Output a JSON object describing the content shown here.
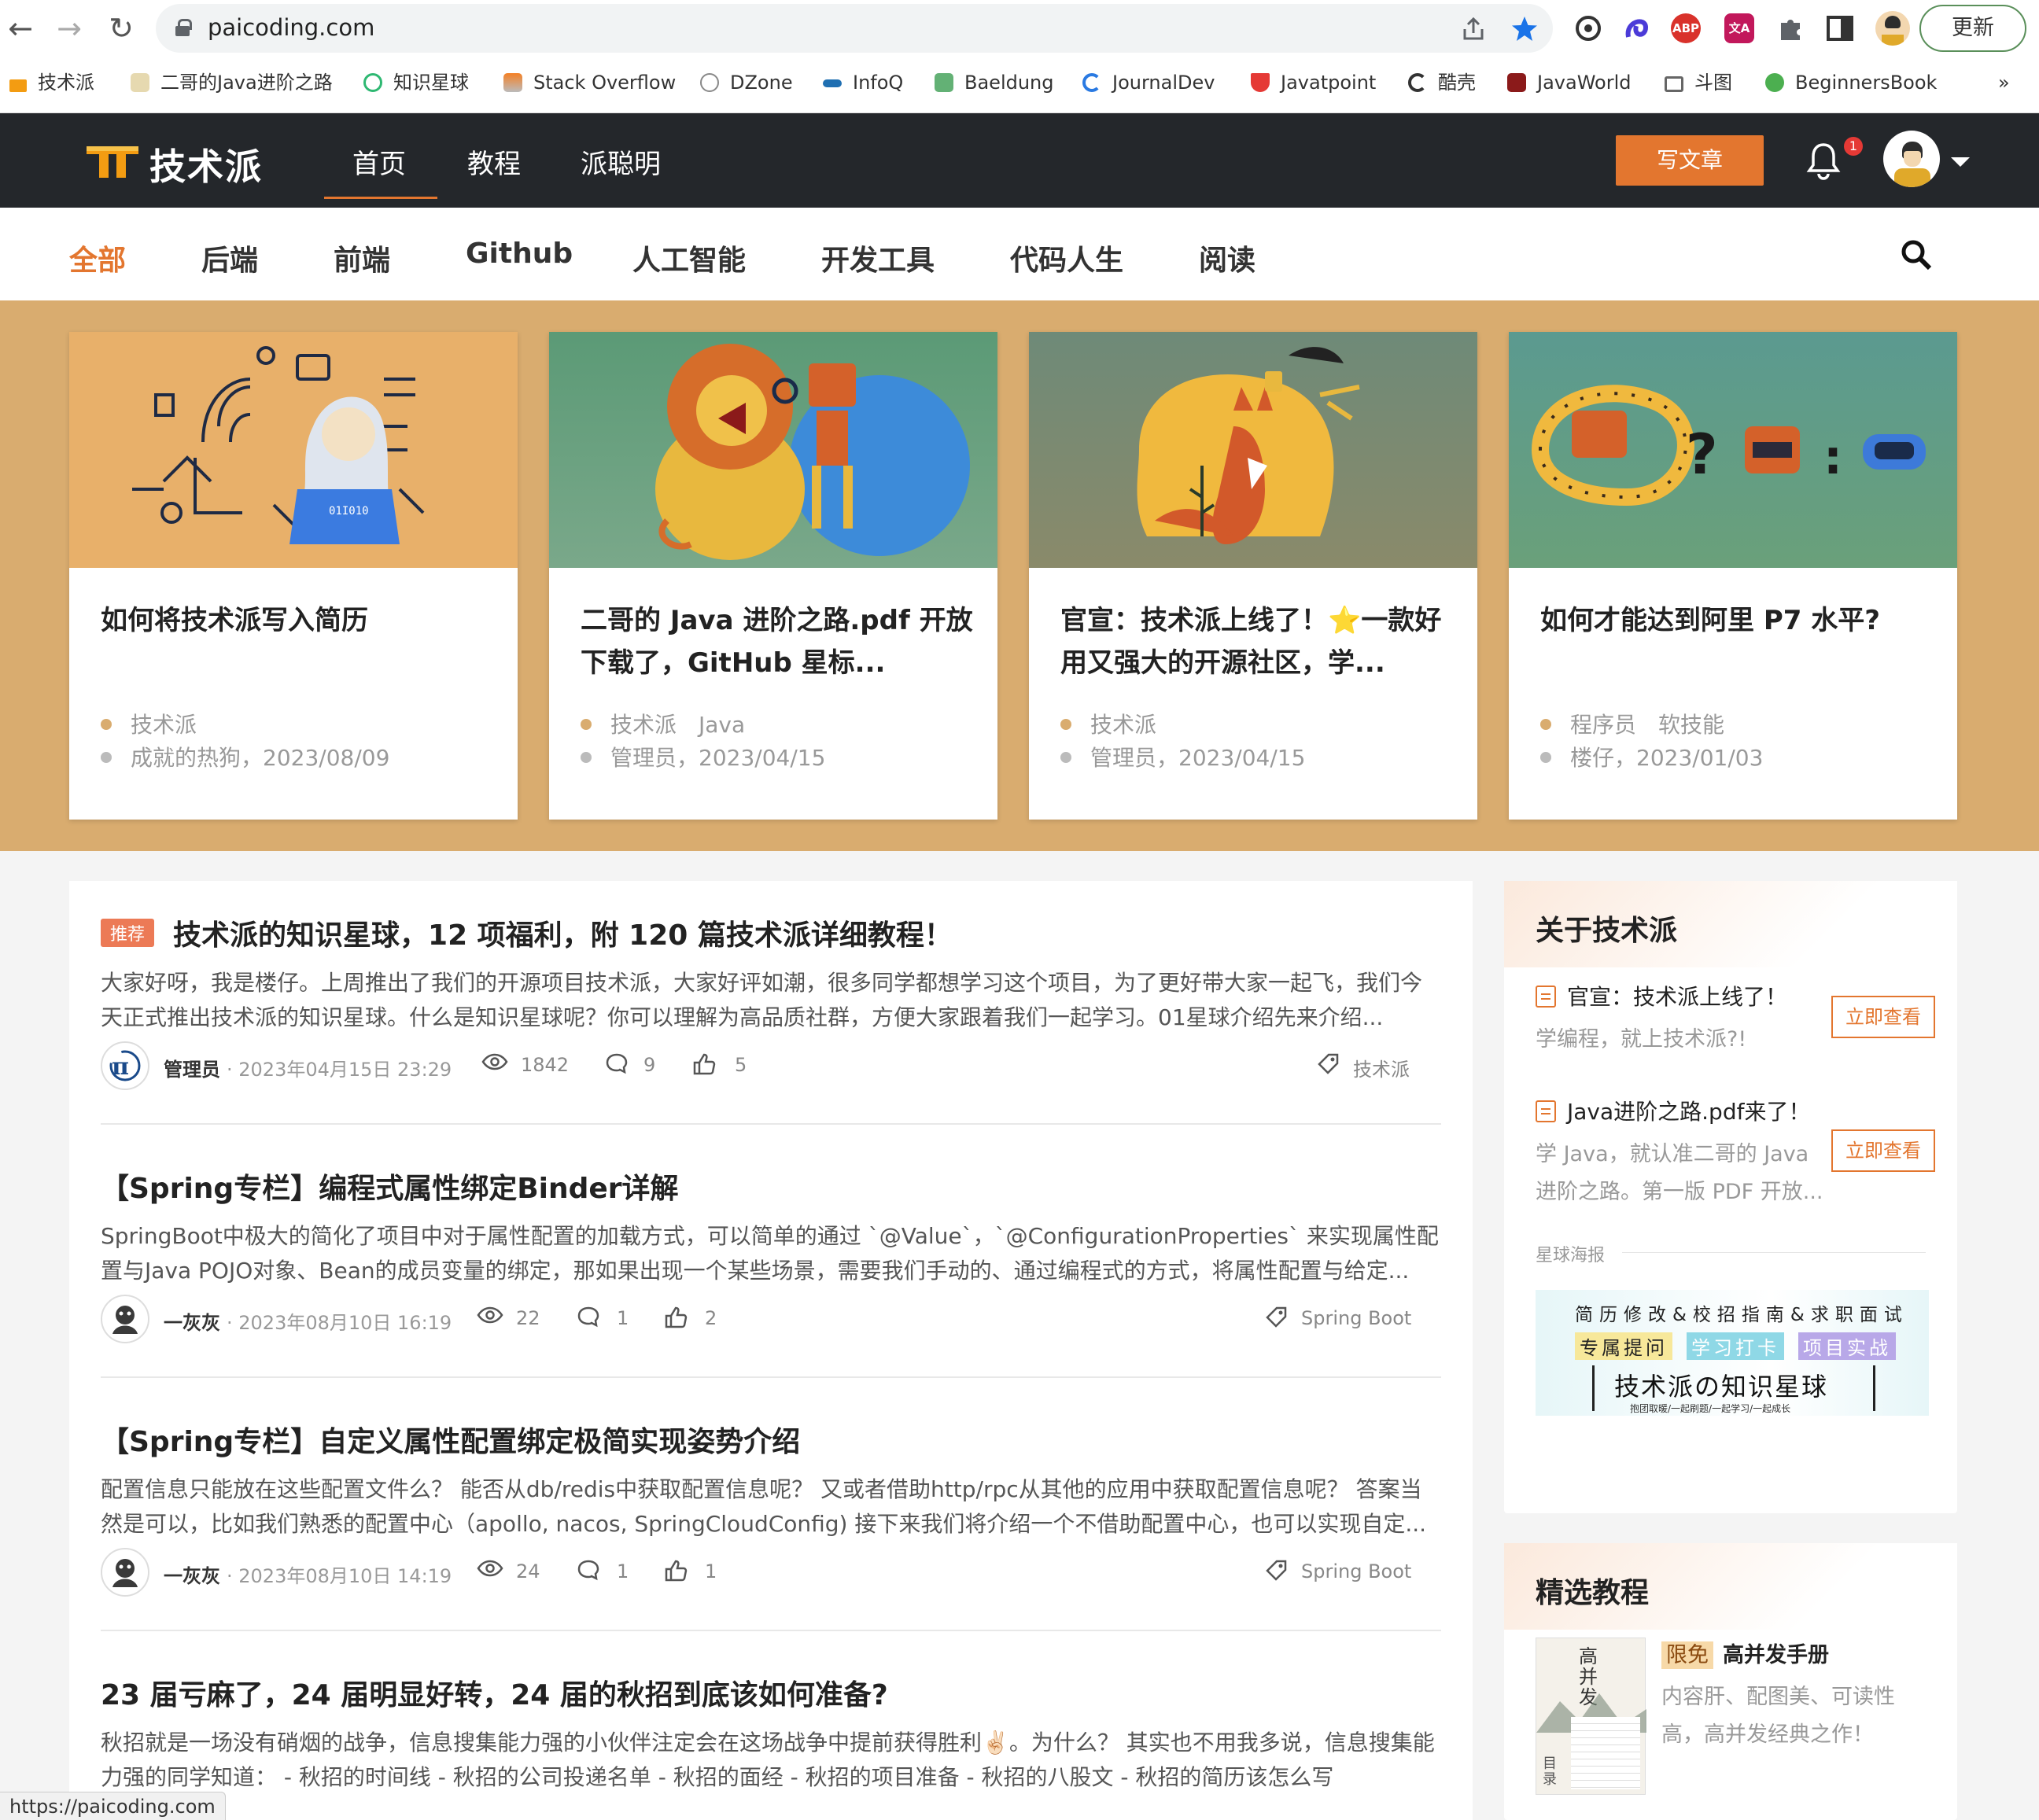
{
  "browser": {
    "url": "paicoding.com",
    "update_label": "更新",
    "status_url": "https://paicoding.com",
    "bookmarks": [
      "技术派",
      "二哥的Java进阶之路",
      "知识星球",
      "Stack Overflow",
      "DZone",
      "InfoQ",
      "Baeldung",
      "JournalDev",
      "Javatpoint",
      "酷壳",
      "JavaWorld",
      "斗图",
      "BeginnersBook"
    ],
    "more": "»"
  },
  "header": {
    "logo": "技术派",
    "nav": [
      "首页",
      "教程",
      "派聪明"
    ],
    "write_label": "写文章",
    "notif_count": "1"
  },
  "categories": [
    "全部",
    "后端",
    "前端",
    "Github",
    "人工智能",
    "开发工具",
    "代码人生",
    "阅读"
  ],
  "hero_cards": [
    {
      "title": "如何将技术派写入简历",
      "tags": "技术派",
      "meta": "成就的热狗，2023/08/09"
    },
    {
      "title": "二哥的 Java 进阶之路.pdf 开放下载了，GitHub 星标...",
      "tags": "技术派　Java",
      "meta": "管理员，2023/04/15"
    },
    {
      "title": "官宣：技术派上线了！⭐一款好用又强大的开源社区，学...",
      "tags": "技术派",
      "meta": "管理员，2023/04/15"
    },
    {
      "title": "如何才能达到阿里 P7 水平?",
      "tags": "程序员　软技能",
      "meta": "楼仔，2023/01/03"
    }
  ],
  "articles": [
    {
      "badge": "推荐",
      "title": "技术派的知识星球，12 项福利，附 120 篇技术派详细教程！",
      "desc": "大家好呀，我是楼仔。上周推出了我们的开源项目技术派，大家好评如潮，很多同学都想学习这个项目，为了更好带大家一起飞，我们今天正式推出技术派的知识星球。什么是知识星球呢？你可以理解为高品质社群，方便大家跟着我们一起学习。01星球介绍先来介绍...",
      "author": "管理员",
      "date": "· 2023年04月15日 23:29",
      "views": "1842",
      "comments": "9",
      "likes": "5",
      "tag": "技术派"
    },
    {
      "title": "【Spring专栏】编程式属性绑定Binder详解",
      "desc": "SpringBoot中极大的简化了项目中对于属性配置的加载方式，可以简单的通过 `@Value`，`@ConfigurationProperties` 来实现属性配置与Java POJO对象、Bean的成员变量的绑定，那如果出现一个某些场景，需要我们手动的、通过编程式的方式，将属性配置与给定...",
      "author": "一灰灰",
      "date": "· 2023年08月10日 16:19",
      "views": "22",
      "comments": "1",
      "likes": "2",
      "tag": "Spring Boot"
    },
    {
      "title": "【Spring专栏】自定义属性配置绑定极简实现姿势介绍",
      "desc": "配置信息只能放在这些配置文件么？ 能否从db/redis中获取配置信息呢？ 又或者借助http/rpc从其他的应用中获取配置信息呢？ 答案当然是可以，比如我们熟悉的配置中心（apollo, nacos, SpringCloudConfig) 接下来我们将介绍一个不借助配置中心，也可以实现自定...",
      "author": "一灰灰",
      "date": "· 2023年08月10日 14:19",
      "views": "24",
      "comments": "1",
      "likes": "1",
      "tag": "Spring Boot"
    },
    {
      "title": "23 届亏麻了，24 届明显好转，24 届的秋招到底该如何准备?",
      "desc": "秋招就是一场没有硝烟的战争，信息搜集能力强的小伙伴注定会在这场战争中提前获得胜利✌🏻。为什么？ 其实也不用我多说，信息搜集能力强的同学知道： - 秋招的时间线 - 秋招的公司投递名单 - 秋招的面经 - 秋招的项目准备 - 秋招的八股文 - 秋招的简历该怎么写"
    }
  ],
  "sidebar": {
    "about_title": "关于技术派",
    "announcements": [
      {
        "title": "官宣：技术派上线了！",
        "sub": "学编程，就上技术派?!",
        "button": "立即查看"
      },
      {
        "title": "Java进阶之路.pdf来了！",
        "sub": "学 Java，就认准二哥的 Java 进阶之路。第一版 PDF 开放...",
        "button": "立即查看"
      }
    ],
    "poster_label": "星球海报",
    "poster": {
      "line1": "简历修改&校招指南&求职面试",
      "chips": [
        "专属提问",
        "学习打卡",
        "项目实战"
      ],
      "main": "技术派の知识星球",
      "sub": "抱团取暖/一起刷题/一起学习/一起成长"
    },
    "tutorial_title": "精选教程",
    "tutorial": {
      "badge": "限免",
      "name": "高并发手册",
      "desc": "内容肝、配图美、可读性高，高并发经典之作！",
      "cover_text": "高并发",
      "cover_side": "目录"
    }
  }
}
